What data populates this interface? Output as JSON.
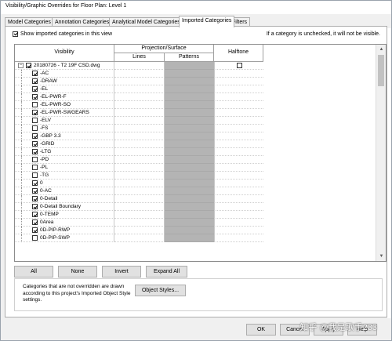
{
  "window": {
    "title": "Visibility/Graphic Overrides for Floor Plan: Level 1"
  },
  "tabs": [
    {
      "label": "Model Categories",
      "active": false
    },
    {
      "label": "Annotation Categories",
      "active": false
    },
    {
      "label": "Analytical Model Categories",
      "active": false
    },
    {
      "label": "Imported Categories",
      "active": true
    },
    {
      "label": "Filters",
      "active": false
    }
  ],
  "show_imported": {
    "label": "Show imported categories in this view",
    "checked": true
  },
  "hint": "If a category is unchecked, it will not be visible.",
  "table": {
    "headers": {
      "visibility": "Visibility",
      "projection_surface": "Projection/Surface",
      "lines": "Lines",
      "patterns": "Patterns",
      "halftone": "Halftone"
    },
    "rows": [
      {
        "label": "20180726 - T2 19F CSD.dwg",
        "checked": true,
        "parent": true,
        "expand": "−",
        "halftone": false
      },
      {
        "label": "-AC",
        "checked": true
      },
      {
        "label": "-DRAW",
        "checked": true
      },
      {
        "label": "-EL",
        "checked": true
      },
      {
        "label": "-EL-PWR-F",
        "checked": true
      },
      {
        "label": "-EL-PWR-SO",
        "checked": false
      },
      {
        "label": "-EL-PWR-SWGEARS",
        "checked": true
      },
      {
        "label": "-ELV",
        "checked": false
      },
      {
        "label": "-FS",
        "checked": false
      },
      {
        "label": "-GBP 3.3",
        "checked": true
      },
      {
        "label": "-GRID",
        "checked": true
      },
      {
        "label": "-LTG",
        "checked": true
      },
      {
        "label": "-PD",
        "checked": false
      },
      {
        "label": "-PL",
        "checked": false
      },
      {
        "label": "-TG",
        "checked": false
      },
      {
        "label": "0",
        "checked": true
      },
      {
        "label": "0-AC",
        "checked": true
      },
      {
        "label": "0-Detail",
        "checked": true
      },
      {
        "label": "0-Detail Boundary",
        "checked": true
      },
      {
        "label": "0-TEMP",
        "checked": true
      },
      {
        "label": "0Area",
        "checked": true
      },
      {
        "label": "0D-PIP-RWP",
        "checked": true
      },
      {
        "label": "0D-PIP-SWP",
        "checked": false
      }
    ]
  },
  "buttons": {
    "all": "All",
    "none": "None",
    "invert": "Invert",
    "expand_all": "Expand All",
    "object_styles": "Object Styles...",
    "ok": "OK",
    "cancel": "Cancel",
    "apply": "Apply",
    "help": "Help"
  },
  "note": "Categories that are not overridden are drawn according to this project's Imported Object Style settings.",
  "watermark": "知乎 @我是歌手233"
}
